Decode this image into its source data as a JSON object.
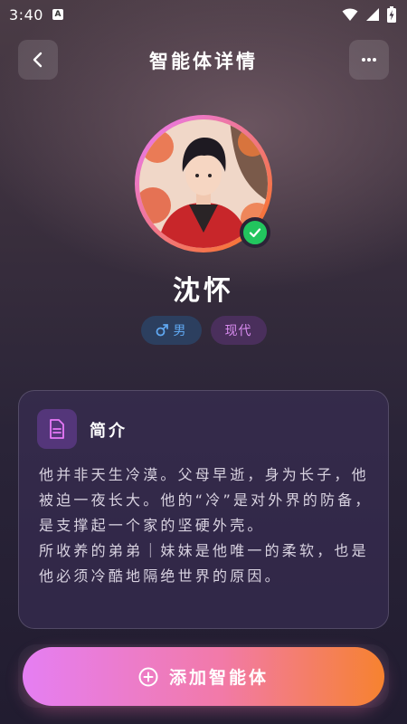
{
  "status_bar": {
    "time": "3:40",
    "notification_badge": "A",
    "icons": [
      "wifi-icon",
      "signal-icon",
      "battery-icon"
    ]
  },
  "header": {
    "title": "智能体详情",
    "back_icon": "chevron-left-icon",
    "more_icon": "more-dots-icon"
  },
  "profile": {
    "avatar_icon": "avatar",
    "verified_icon": "check-icon",
    "name": "沈怀",
    "tags": [
      {
        "icon": "male-icon",
        "label": "男"
      },
      {
        "label": "现代"
      }
    ]
  },
  "intro": {
    "icon": "document-icon",
    "title": "简介",
    "text": "他并非天生冷漠。父母早逝，身为长子，他被迫一夜长大。他的“冷”是对外界的防备，是支撑起一个家的坚硬外壳。\n所收养的弟弟｜妹妹是他唯一的柔软，也是他必须冷酷地隔绝世界的原因。"
  },
  "action": {
    "icon": "plus-circle-icon",
    "label": "添加智能体"
  },
  "colors": {
    "accent_start": "#e57ef3",
    "accent_end": "#f6822f",
    "verified": "#22c55e",
    "gender_tag_text": "#5fa7f0",
    "era_tag_text": "#d98cf0"
  }
}
